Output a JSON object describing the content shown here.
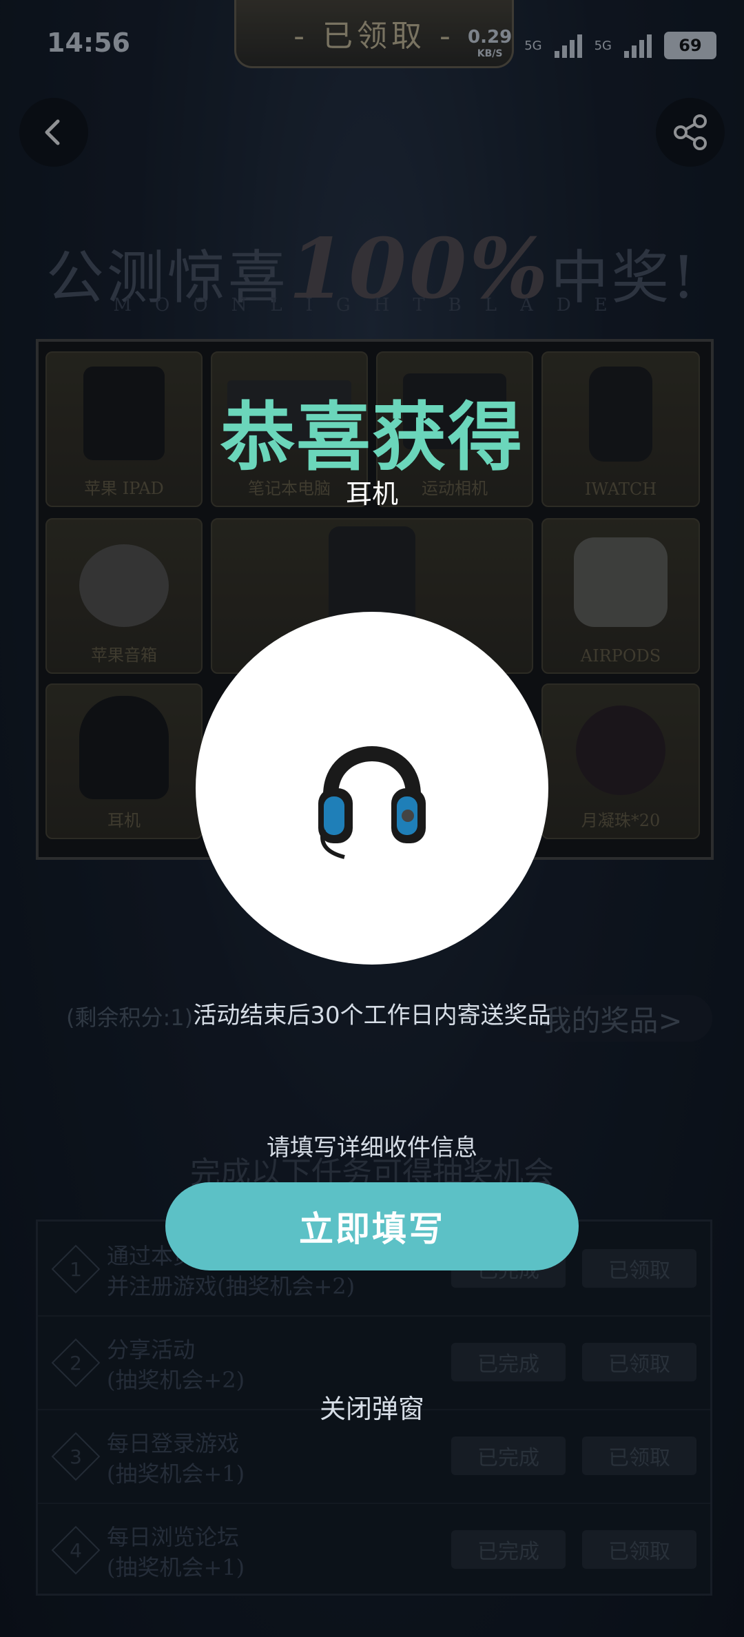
{
  "status": {
    "time": "14:56",
    "net_speed": "0.29",
    "net_unit": "KB/S",
    "net1": "5G",
    "net2": "5G",
    "battery": "69"
  },
  "banner": "- 已领取 -",
  "headline": {
    "pre": "公测惊喜",
    "big": "100%",
    "post": "中奖!",
    "sub": "MOONLIGHTBLADE"
  },
  "prizes": [
    {
      "label": "苹果 IPAD"
    },
    {
      "label": "笔记本电脑"
    },
    {
      "label": "运动相机"
    },
    {
      "label": "IWATCH"
    },
    {
      "label": "苹果音箱"
    },
    {
      "label": "AIRPODS"
    },
    {
      "label": "耳机"
    },
    {
      "label": "月凝珠*20"
    }
  ],
  "remaining": "(剩余积分:1)",
  "my_prizes": "我的奖品>",
  "tasks_title": "完成以下任务可得抽奖机会",
  "tasks": [
    {
      "num": "1",
      "line1": "通过本页下载",
      "line2": "并注册游戏(抽奖机会+2)",
      "done": "已完成",
      "claim": "已领取"
    },
    {
      "num": "2",
      "line1": "分享活动",
      "line2": "(抽奖机会+2)",
      "done": "已完成",
      "claim": "已领取"
    },
    {
      "num": "3",
      "line1": "每日登录游戏",
      "line2": "(抽奖机会+1)",
      "done": "已完成",
      "claim": "已领取"
    },
    {
      "num": "4",
      "line1": "每日浏览论坛",
      "line2": "(抽奖机会+1)",
      "done": "已完成",
      "claim": "已领取"
    }
  ],
  "modal": {
    "title": "恭喜获得",
    "prize": "耳机",
    "note": "活动结束后30个工作日内寄送奖品",
    "hint": "请填写详细收件信息",
    "fill_button": "立即填写",
    "close": "关闭弹窗"
  },
  "colors": {
    "accent": "#5cc1c6",
    "title_green": "#6bd6bb"
  }
}
